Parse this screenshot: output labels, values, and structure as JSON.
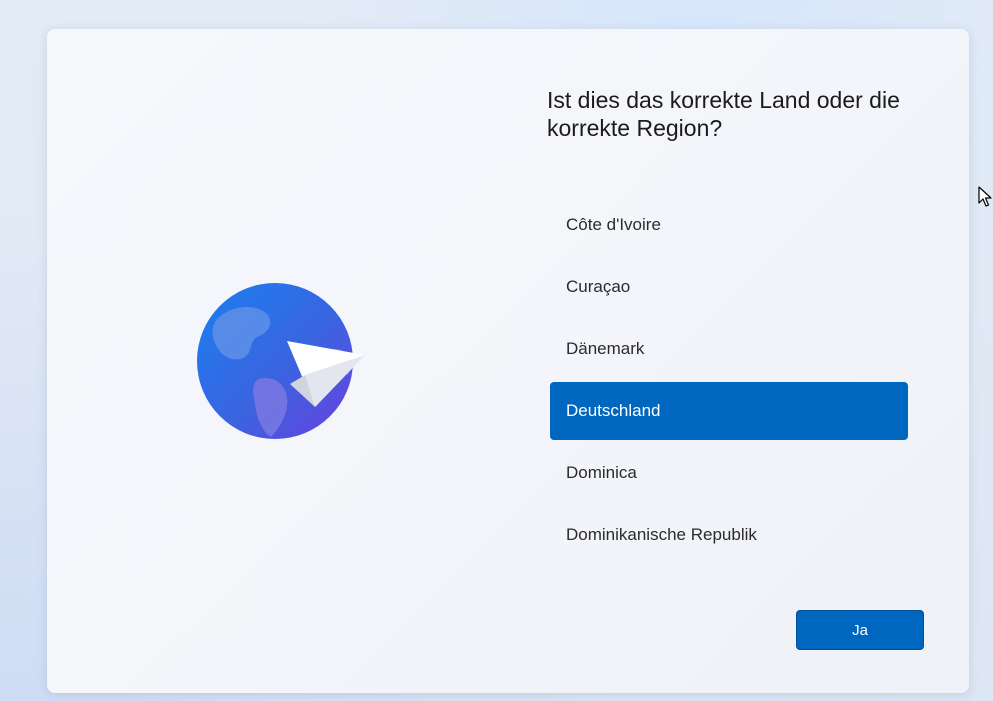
{
  "dialog": {
    "title": "Ist dies das korrekte Land oder die korrekte Region?",
    "illustration": "globe-with-paper-plane-icon"
  },
  "regions": {
    "items": [
      {
        "label": "Côte d'Ivoire",
        "selected": false
      },
      {
        "label": "Curaçao",
        "selected": false
      },
      {
        "label": "Dänemark",
        "selected": false
      },
      {
        "label": "Deutschland",
        "selected": true
      },
      {
        "label": "Dominica",
        "selected": false
      },
      {
        "label": "Dominikanische Republik",
        "selected": false
      }
    ]
  },
  "actions": {
    "confirm_label": "Ja"
  },
  "colors": {
    "accent": "#0067c0",
    "text": "#1b1b1b"
  }
}
